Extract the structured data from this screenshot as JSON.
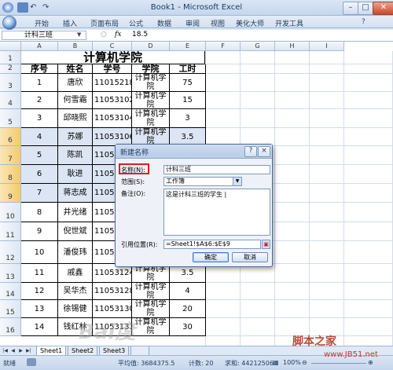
{
  "window": {
    "title": "Book1 - Microsoft Excel"
  },
  "ribbon_tabs": [
    "开始",
    "插入",
    "页面布局",
    "公式",
    "数据",
    "审阅",
    "视图",
    "美化大师",
    "开发工具"
  ],
  "formula_bar": {
    "name_box": "计科三班",
    "fx": "fx",
    "value": "18.5"
  },
  "columns": [
    "A",
    "B",
    "C",
    "D",
    "E",
    "F",
    "G",
    "H",
    "I"
  ],
  "sheet_title": "计算机学院",
  "headers": [
    "序号",
    "姓名",
    "学号",
    "学院",
    "工时"
  ],
  "rows": [
    {
      "n": "3",
      "idx": "1",
      "name": "唐欣",
      "id": "11015218",
      "dept": "计算机学院",
      "hours": "75"
    },
    {
      "n": "4",
      "idx": "2",
      "name": "何雪霜",
      "id": "11053102",
      "dept": "计算机学院",
      "hours": "15"
    },
    {
      "n": "5",
      "idx": "3",
      "name": "邱晓熙",
      "id": "11053104",
      "dept": "计算机学院",
      "hours": "3"
    },
    {
      "n": "6",
      "idx": "4",
      "name": "苏娜",
      "id": "11053106",
      "dept": "计算机学院",
      "hours": "3.5"
    },
    {
      "n": "7",
      "idx": "5",
      "name": "陈凯",
      "id": "11053",
      "dept": "",
      "hours": ""
    },
    {
      "n": "8",
      "idx": "6",
      "name": "耿进",
      "id": "11053",
      "dept": "",
      "hours": ""
    },
    {
      "n": "9",
      "idx": "7",
      "name": "蒋志成",
      "id": "11053",
      "dept": "",
      "hours": ""
    },
    {
      "n": "10",
      "idx": "8",
      "name": "井光绪",
      "id": "11053",
      "dept": "",
      "hours": ""
    },
    {
      "n": "11",
      "idx": "9",
      "name": "倪世斌",
      "id": "11053",
      "dept": "",
      "hours": ""
    },
    {
      "n": "12",
      "idx": "10",
      "name": "潘俊玮",
      "id": "11053",
      "dept": "",
      "hours": ""
    },
    {
      "n": "13",
      "idx": "11",
      "name": "戚鑫",
      "id": "11053124",
      "dept": "计算机学院",
      "hours": "3.5"
    },
    {
      "n": "14",
      "idx": "12",
      "name": "吴华杰",
      "id": "11053128",
      "dept": "计算机学院",
      "hours": "4"
    },
    {
      "n": "15",
      "idx": "13",
      "name": "徐锡健",
      "id": "11053130",
      "dept": "计算机学院",
      "hours": "20"
    },
    {
      "n": "16",
      "idx": "14",
      "name": "钱红林",
      "id": "11053133",
      "dept": "计算机学院",
      "hours": "30"
    }
  ],
  "sheet_tabs": [
    "Sheet1",
    "Sheet2",
    "Sheet3"
  ],
  "status": {
    "ready": "就绪",
    "average": "平均值: 3684375.5",
    "count": "计数: 20",
    "sum": "求和: 44212506",
    "zoom": "100%"
  },
  "dialog": {
    "title": "新建名称",
    "help": "?",
    "close": "×",
    "name_label": "名称(N):",
    "name_value": "计科三班",
    "scope_label": "范围(S):",
    "scope_value": "工作簿",
    "comment_label": "备注(O):",
    "comment_value": "这是计科三班的学生 |",
    "ref_label": "引用位置(R):",
    "ref_value": "=Sheet1!$A$6:$E$9",
    "ok": "确定",
    "cancel": "取消"
  },
  "watermark": {
    "brand": "脚本之家",
    "url": "www.JB51.net",
    "logo": "Bai度"
  },
  "colors": {
    "selection": "#dce5f3",
    "highlight": "#e21b1b",
    "header": "#dde7f3"
  }
}
